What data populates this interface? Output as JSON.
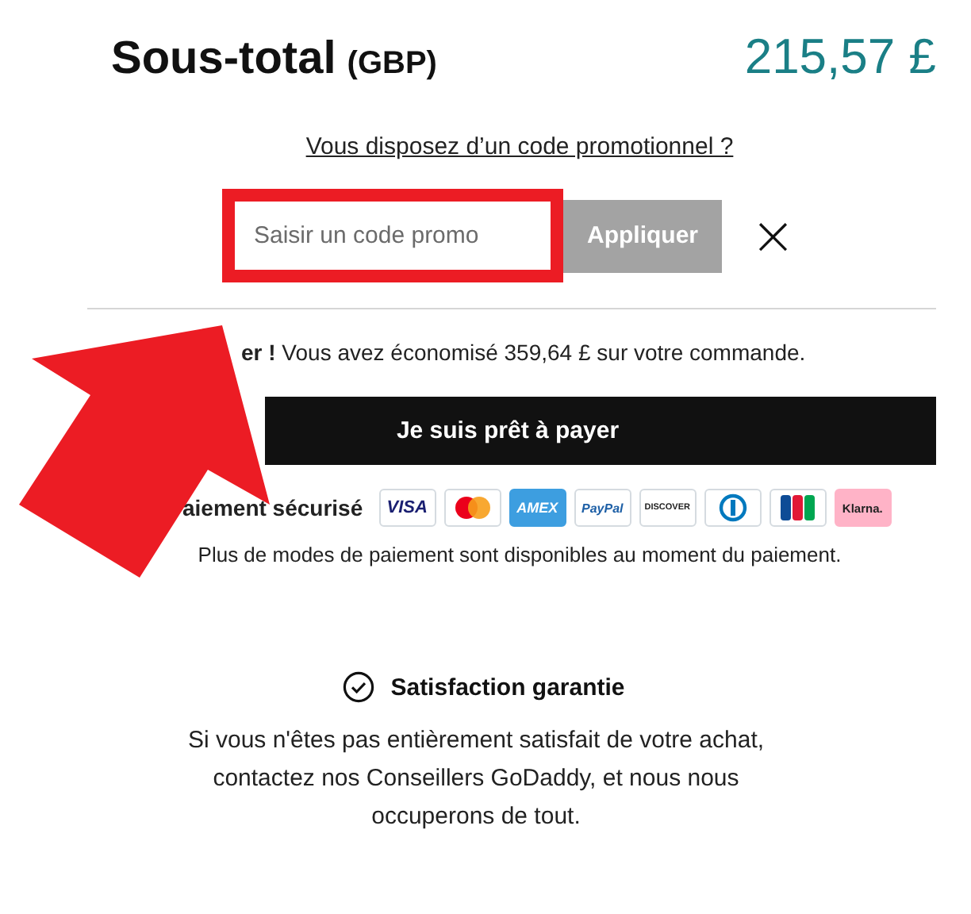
{
  "subtotal": {
    "label": "Sous-total",
    "currency": "(GBP)",
    "amount": "215,57 £"
  },
  "promo": {
    "link": "Vous disposez d’un code promotionnel ?",
    "placeholder": "Saisir un code promo",
    "apply": "Appliquer",
    "close": "×",
    "highlighted": true
  },
  "savings": "**er !** Vous avez économisé 359,64 £ sur votre commande.",
  "pay_button": "Je suis prêt à payer",
  "secure": {
    "label": "aiement sécurisé",
    "methods": [
      {
        "kind": "label",
        "label": "VISA",
        "color": "#ffffff"
      },
      {
        "kind": "circles",
        "color": "#ffffff"
      },
      {
        "kind": "label",
        "label": "AMEX",
        "color": "#3d9ee0"
      },
      {
        "kind": "label",
        "label": "PayPal",
        "color": "#ffffff"
      },
      {
        "kind": "label",
        "label": "DISCOVER",
        "color": "#ffffff"
      },
      {
        "kind": "ring",
        "color": "#ffffff"
      },
      {
        "kind": "stripes",
        "color": "#ffffff"
      },
      {
        "kind": "label",
        "label": "Klarna.",
        "color": "#ffb3c7"
      }
    ],
    "note": "Plus de modes de paiement sont disponibles au moment du paiement."
  },
  "guarantee": {
    "title": "Satisfaction garantie",
    "text": "Si vous n'êtes pas entièrement satisfait de votre achat, contactez nos Conseillers GoDaddy, et nous nous occuperons de tout."
  },
  "annotation": {
    "arrow": true
  }
}
